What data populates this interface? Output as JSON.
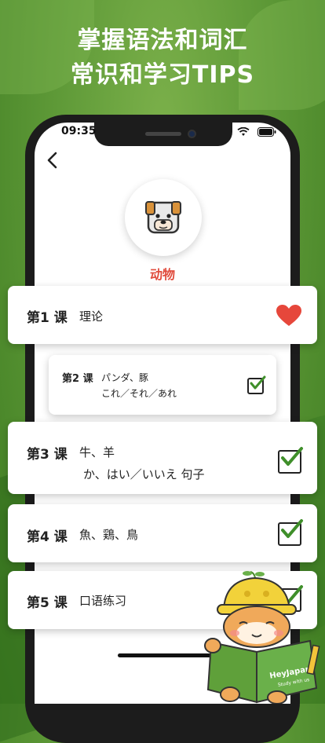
{
  "headline": {
    "line1": "掌握语法和词汇",
    "line2": "常识和学习TIPS"
  },
  "status_bar": {
    "time": "09:35",
    "icons": [
      "wifi-icon",
      "battery-icon"
    ]
  },
  "header": {
    "back_icon": "chevron-left-icon",
    "category_icon": "dog-icon",
    "category_title": "动物"
  },
  "lessons": [
    {
      "number": "第1 课",
      "line1": "理论",
      "line2": "",
      "status_icon": "heart-icon"
    },
    {
      "number": "第2 课",
      "line1": "パンダ、豚",
      "line2": "これ／それ／あれ",
      "status_icon": "checkbox-checked-icon"
    },
    {
      "number": "第3 课",
      "line1": "牛、羊",
      "line2": "か、はい／いいえ 句子",
      "status_icon": "checkbox-checked-icon"
    },
    {
      "number": "第4 课",
      "line1": "魚、鶏、鳥",
      "line2": "",
      "status_icon": "checkbox-checked-icon"
    },
    {
      "number": "第5 课",
      "line1": "口语练习",
      "line2": "",
      "status_icon": "checkbox-checked-icon"
    }
  ],
  "mascot": {
    "book_brand": "HeyJapan",
    "book_tagline": "Study with us"
  },
  "colors": {
    "background": "#5f9a38",
    "accent_red": "#e04b3c",
    "check_green": "#3f8f2a"
  }
}
